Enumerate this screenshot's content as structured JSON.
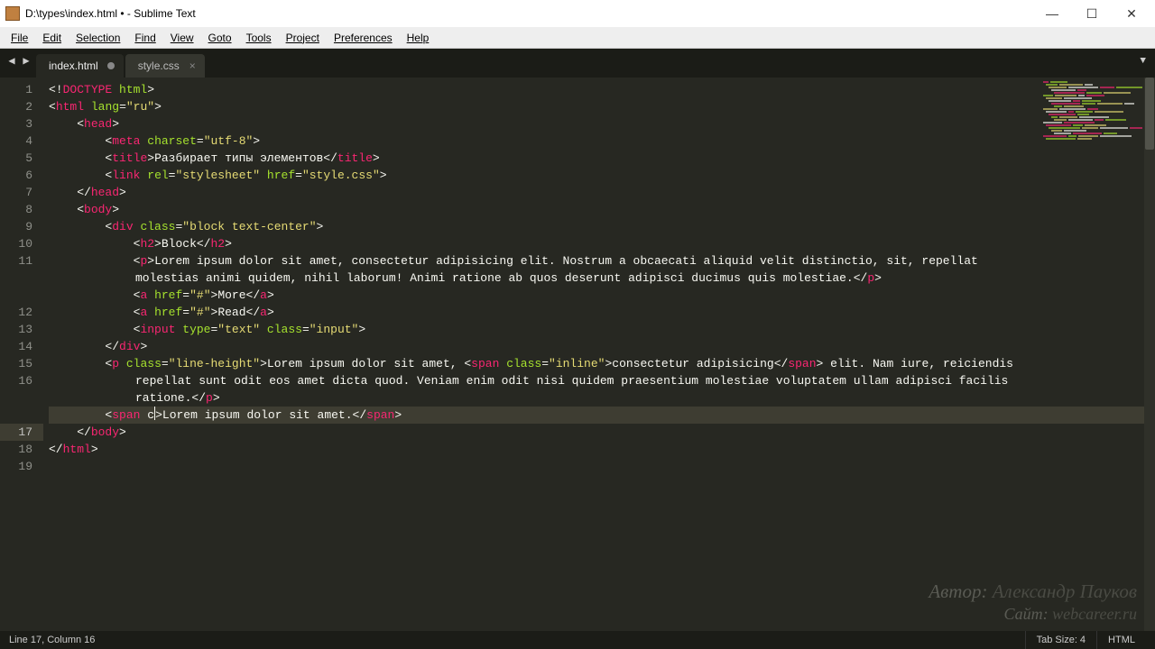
{
  "window": {
    "title": "D:\\types\\index.html • - Sublime Text"
  },
  "menu": [
    "File",
    "Edit",
    "Selection",
    "Find",
    "View",
    "Goto",
    "Tools",
    "Project",
    "Preferences",
    "Help"
  ],
  "tabs": [
    {
      "label": "index.html",
      "active": true,
      "dirty": true
    },
    {
      "label": "style.css",
      "active": false,
      "dirty": false
    }
  ],
  "status": {
    "position": "Line 17, Column 16",
    "tab_size": "Tab Size: 4",
    "syntax": "HTML"
  },
  "gutter_lines": [
    "1",
    "2",
    "3",
    "4",
    "5",
    "6",
    "7",
    "8",
    "9",
    "10",
    "11",
    "12",
    "13",
    "14",
    "15",
    "16",
    "17",
    "18",
    "19"
  ],
  "highlight_line": 17,
  "code": {
    "l1": {
      "pre": "",
      "open": "<!",
      "tag": "DOCTYPE",
      "rest": " html",
      "close": ">"
    },
    "l2": {
      "indent": "",
      "tag": "html",
      "attr1": "lang",
      "val1": "\"ru\""
    },
    "l3": {
      "indent": "    ",
      "tag": "head"
    },
    "l4": {
      "indent": "        ",
      "tag": "meta",
      "attr1": "charset",
      "val1": "\"utf-8\""
    },
    "l5": {
      "indent": "        ",
      "tag": "title",
      "text": "Разбирает типы элементов"
    },
    "l6": {
      "indent": "        ",
      "tag": "link",
      "attr1": "rel",
      "val1": "\"stylesheet\"",
      "attr2": "href",
      "val2": "\"style.css\""
    },
    "l7": {
      "indent": "    ",
      "tag": "head"
    },
    "l8": {
      "indent": "    ",
      "tag": "body"
    },
    "l9": {
      "indent": "        ",
      "tag": "div",
      "attr1": "class",
      "val1": "\"block text-center\""
    },
    "l10": {
      "indent": "            ",
      "tag": "h2",
      "text": "Block"
    },
    "l11": {
      "indent": "            ",
      "tag": "p",
      "text": "Lorem ipsum dolor sit amet, consectetur adipisicing elit. Nostrum a obcaecati aliquid velit distinctio, sit, repellat molestias animi quidem, nihil laborum! Animi ratione ab quos deserunt adipisci ducimus quis molestiae."
    },
    "l12": {
      "indent": "            ",
      "tag": "a",
      "attr1": "href",
      "val1": "\"#\"",
      "text": "More"
    },
    "l13": {
      "indent": "            ",
      "tag": "a",
      "attr1": "href",
      "val1": "\"#\"",
      "text": "Read"
    },
    "l14": {
      "indent": "            ",
      "tag": "input",
      "attr1": "type",
      "val1": "\"text\"",
      "attr2": "class",
      "val2": "\"input\""
    },
    "l15": {
      "indent": "        ",
      "tag": "div"
    },
    "l16": {
      "indent": "        ",
      "tag": "p",
      "attr1": "class",
      "val1": "\"line-height\"",
      "text_a": "Lorem ipsum dolor sit amet, ",
      "inner_tag": "span",
      "inner_attr": "class",
      "inner_val": "\"inline\"",
      "inner_text": "consectetur adipisicing",
      "text_b": " elit. Nam iure, reiciendis repellat sunt odit eos amet dicta quod. Veniam enim odit nisi quidem praesentium molestiae voluptatem ullam adipisci facilis ratione."
    },
    "l17": {
      "indent": "        ",
      "tag": "span",
      "partial": "c",
      "text": "Lorem ipsum dolor sit amet."
    },
    "l18": {
      "indent": "    ",
      "tag": "body"
    },
    "l19": {
      "indent": "",
      "tag": "html"
    }
  },
  "watermark": {
    "author_label": "Автор:",
    "author": "Александр Пауков",
    "site_label": "Сайт:",
    "site": "webcareer.ru"
  }
}
